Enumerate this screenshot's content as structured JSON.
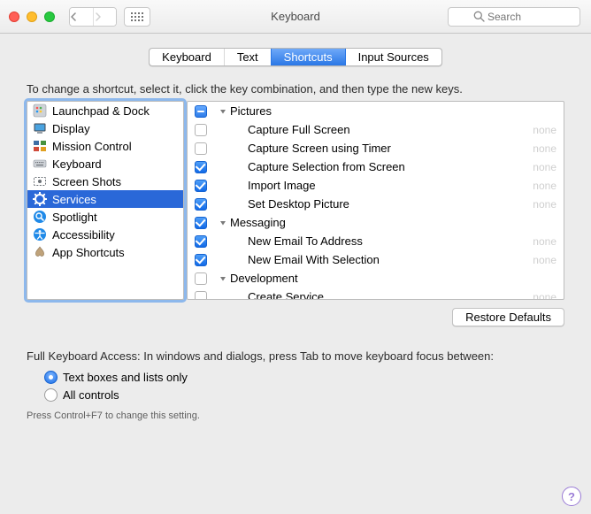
{
  "window": {
    "title": "Keyboard",
    "search_placeholder": "Search"
  },
  "tabs": [
    {
      "label": "Keyboard",
      "active": false
    },
    {
      "label": "Text",
      "active": false
    },
    {
      "label": "Shortcuts",
      "active": true
    },
    {
      "label": "Input Sources",
      "active": false
    }
  ],
  "instruction": "To change a shortcut, select it, click the key combination, and then type the new keys.",
  "categories": [
    {
      "label": "Launchpad & Dock",
      "icon": "launchpad",
      "selected": false
    },
    {
      "label": "Display",
      "icon": "display",
      "selected": false
    },
    {
      "label": "Mission Control",
      "icon": "mission-control",
      "selected": false
    },
    {
      "label": "Keyboard",
      "icon": "keyboard",
      "selected": false
    },
    {
      "label": "Screen Shots",
      "icon": "screenshots",
      "selected": false
    },
    {
      "label": "Services",
      "icon": "services",
      "selected": true
    },
    {
      "label": "Spotlight",
      "icon": "spotlight",
      "selected": false
    },
    {
      "label": "Accessibility",
      "icon": "accessibility",
      "selected": false
    },
    {
      "label": "App Shortcuts",
      "icon": "app-shortcuts",
      "selected": false
    }
  ],
  "shortcuts": [
    {
      "type": "group",
      "label": "Pictures",
      "state": "mixed",
      "expanded": true
    },
    {
      "type": "item",
      "label": "Capture Full Screen",
      "state": "off",
      "key": "none"
    },
    {
      "type": "item",
      "label": "Capture Screen using Timer",
      "state": "off",
      "key": "none"
    },
    {
      "type": "item",
      "label": "Capture Selection from Screen",
      "state": "on",
      "key": "none"
    },
    {
      "type": "item",
      "label": "Import Image",
      "state": "on",
      "key": "none"
    },
    {
      "type": "item",
      "label": "Set Desktop Picture",
      "state": "on",
      "key": "none"
    },
    {
      "type": "group",
      "label": "Messaging",
      "state": "on",
      "expanded": true
    },
    {
      "type": "item",
      "label": "New Email To Address",
      "state": "on",
      "key": "none"
    },
    {
      "type": "item",
      "label": "New Email With Selection",
      "state": "on",
      "key": "none"
    },
    {
      "type": "group",
      "label": "Development",
      "state": "off",
      "expanded": true
    },
    {
      "type": "item",
      "label": "Create Service",
      "state": "off",
      "key": "none"
    }
  ],
  "restore_label": "Restore Defaults",
  "fka": {
    "heading": "Full Keyboard Access: In windows and dialogs, press Tab to move keyboard focus between:",
    "options": [
      {
        "label": "Text boxes and lists only",
        "selected": true
      },
      {
        "label": "All controls",
        "selected": false
      }
    ],
    "hint": "Press Control+F7 to change this setting."
  }
}
